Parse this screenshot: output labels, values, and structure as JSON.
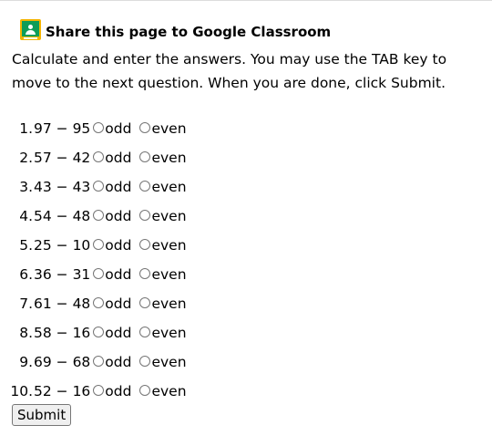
{
  "header": {
    "share_link": "Share this page to Google Classroom",
    "icon": "google-classroom-icon"
  },
  "instructions": "Calculate and enter the answers. You may use the TAB key to move to the next question. When you are done, click Submit.",
  "option_labels": {
    "odd": "odd",
    "even": "even"
  },
  "questions": [
    {
      "number": "1.",
      "expression": "97 − 95"
    },
    {
      "number": "2.",
      "expression": "57 − 42"
    },
    {
      "number": "3.",
      "expression": "43 − 43"
    },
    {
      "number": "4.",
      "expression": "54 − 48"
    },
    {
      "number": "5.",
      "expression": "25 − 10"
    },
    {
      "number": "6.",
      "expression": "36 − 31"
    },
    {
      "number": "7.",
      "expression": "61 − 48"
    },
    {
      "number": "8.",
      "expression": "58 − 16"
    },
    {
      "number": "9.",
      "expression": "69 − 68"
    },
    {
      "number": "10.",
      "expression": "52 − 16"
    }
  ],
  "submit_label": "Submit"
}
